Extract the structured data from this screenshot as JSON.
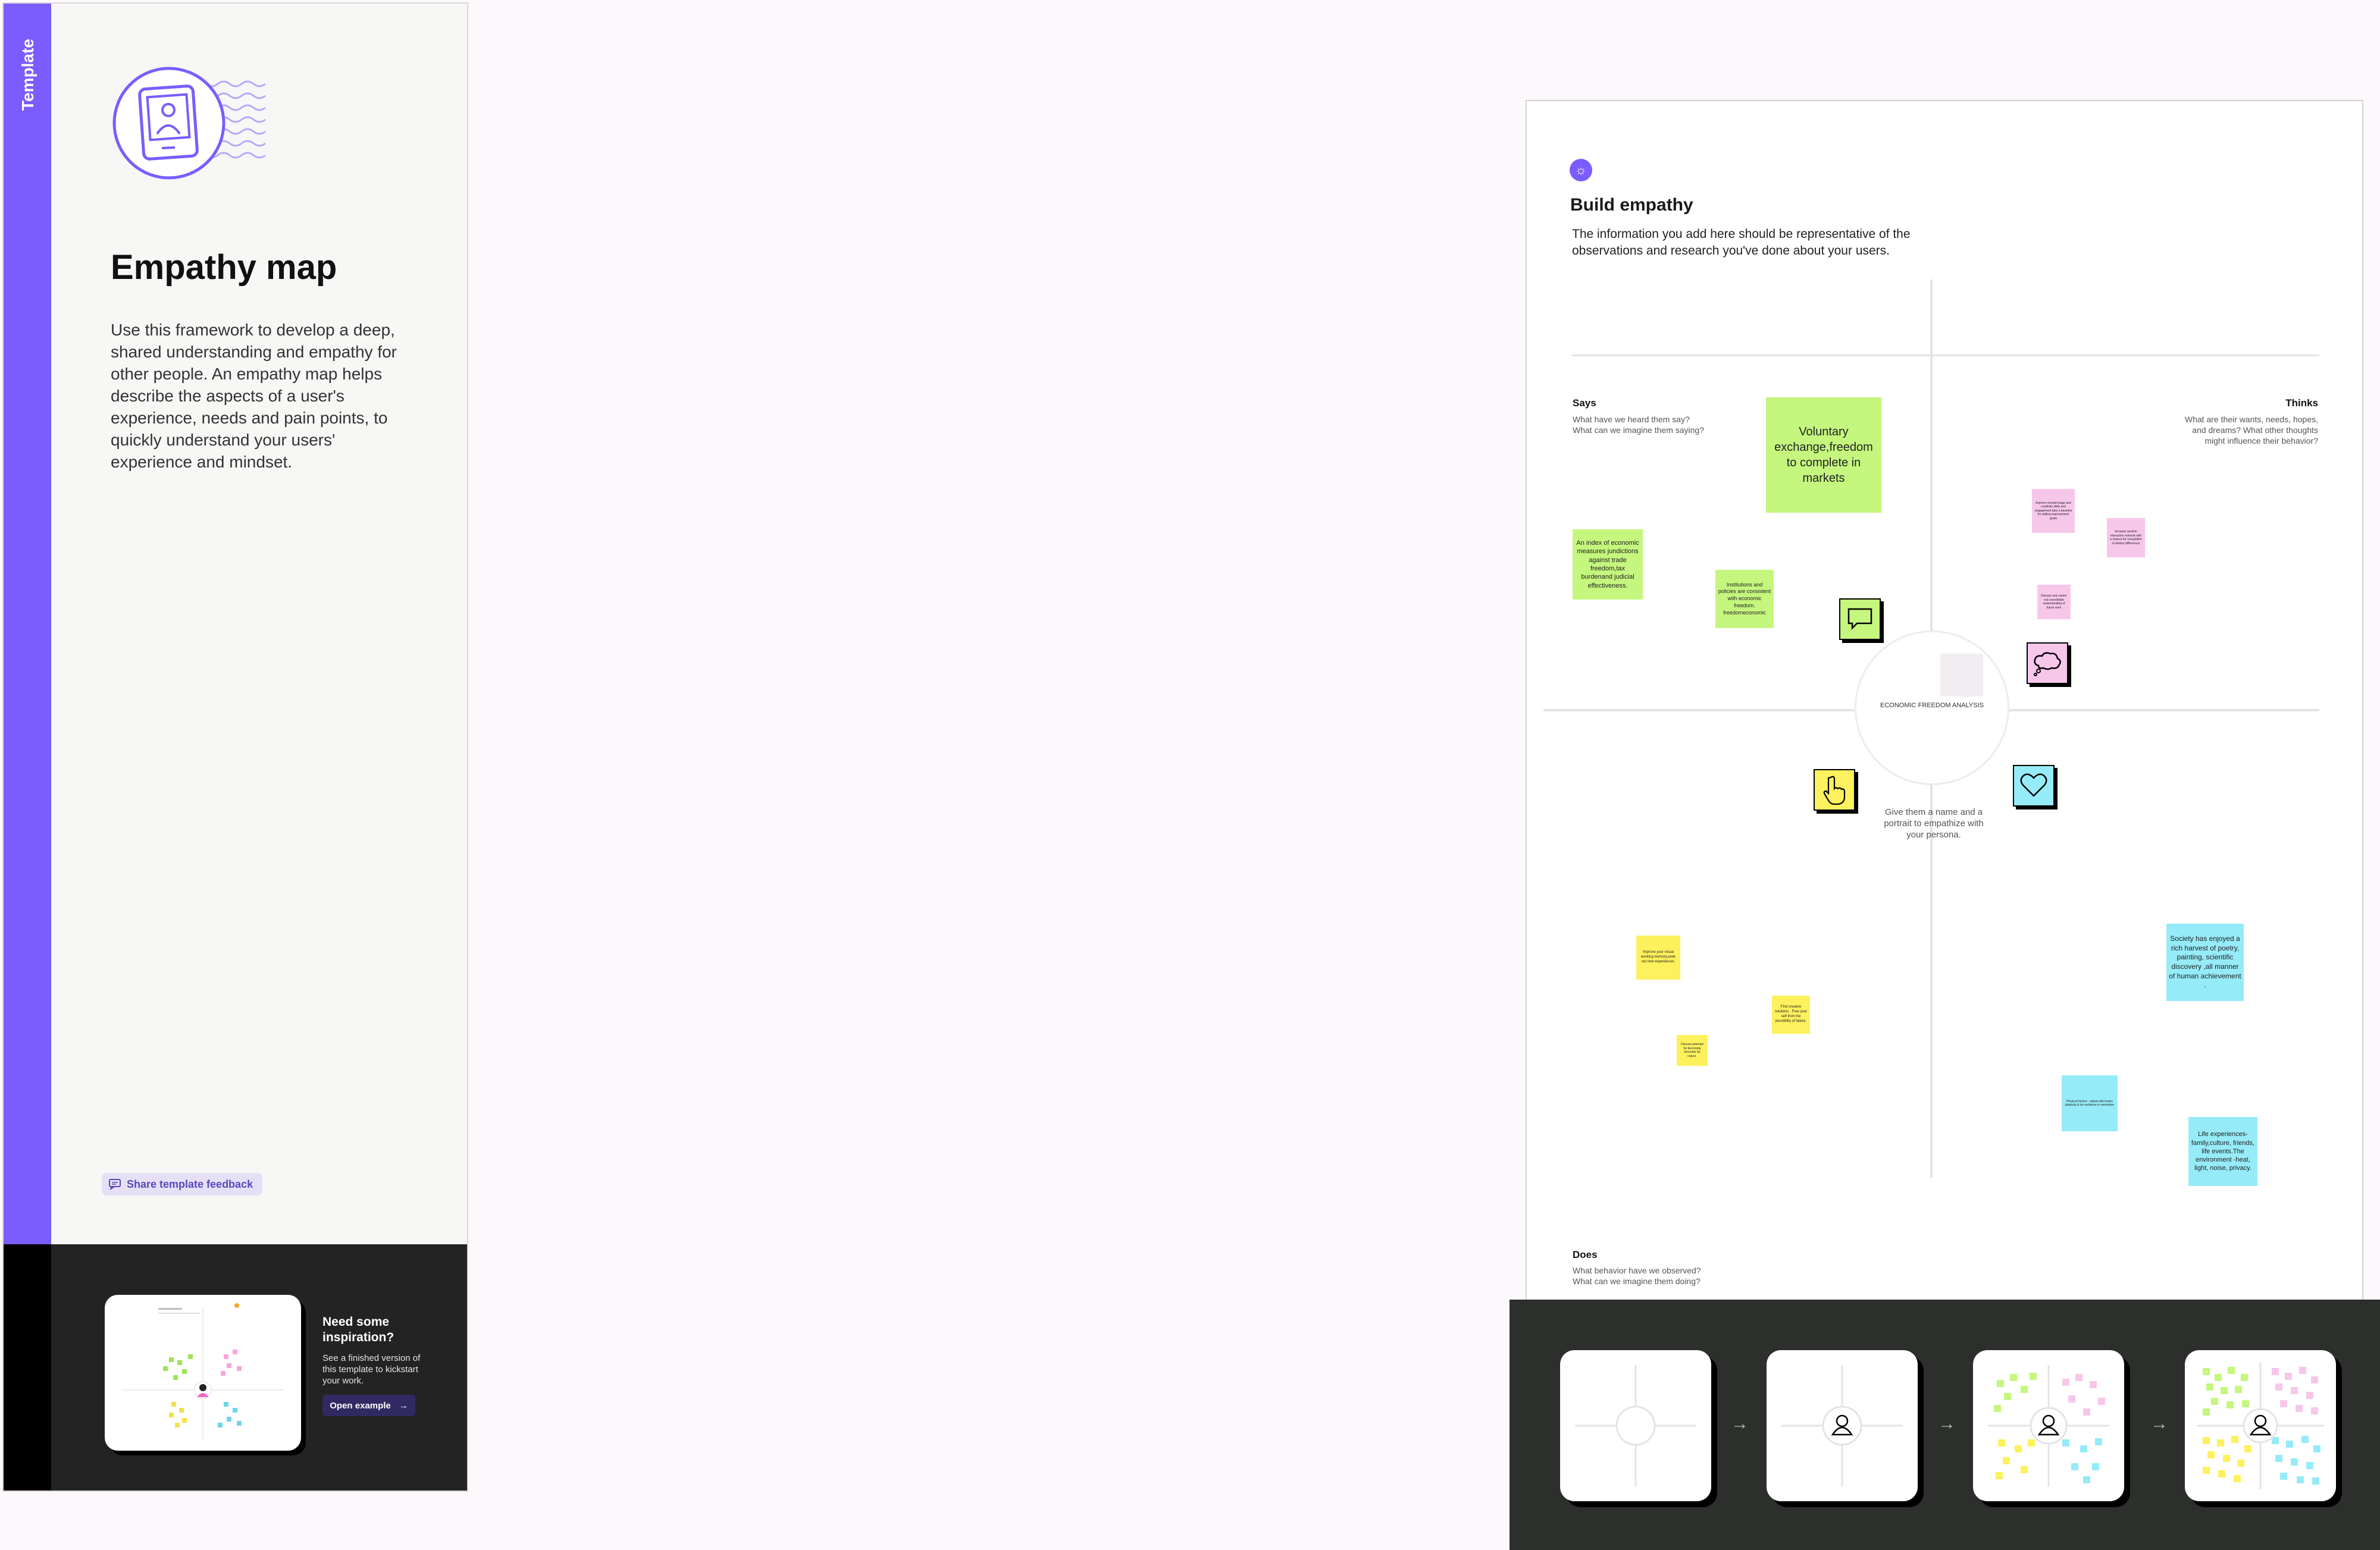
{
  "template_panel": {
    "tab_label": "Template",
    "title": "Empathy map",
    "description": "Use this framework to develop a deep, shared understanding and empathy for other people. An empathy map helps describe the aspects of a user's experience, needs and pain points, to quickly understand your users' experience and mindset.",
    "feedback_button": "Share template feedback",
    "inspiration": {
      "title": "Need some inspiration?",
      "description": "See a finished version of this template to kickstart your work.",
      "button": "Open example"
    }
  },
  "board": {
    "heading": "Build empathy",
    "description": "The information you add here should be representative of the observations and research you've done about your users.",
    "center_label": "ECONOMIC FREEDOM ANALYSIS",
    "persona_hint": "Give them a name and a portrait to empathize with your persona.",
    "quadrants": {
      "says": {
        "title": "Says",
        "desc1": "What have we heard them say?",
        "desc2": "What can we imagine them saying?"
      },
      "thinks": {
        "title": "Thinks",
        "desc1": "What are their wants, needs, hopes,",
        "desc2": "and dreams? What other thoughts",
        "desc3": "might influence their behavior?"
      },
      "does": {
        "title": "Does",
        "desc1": "What behavior have we observed?",
        "desc2": "What can we imagine them doing?"
      }
    },
    "stickies": {
      "voluntary": "Voluntary exchange,freedom to complete in markets",
      "index": "An index of economic measures jundictions against trade freedom,tax burdenand judicial effectiveness.",
      "institutions": "Institutions and policies are consistent with economic freedom. freedomeconomic",
      "pink1": "Improve mental image and creativity skills and engagement take a baseline for skilling improvement goals",
      "pink2": "Increase random interaction network with a chance for recognition of distinct differences",
      "pink3": "Discuss new career out consolidate understanding of future work",
      "yellow1": "Improve your visual working memory,seek out new experiences.",
      "yellow2": "Find creative solutions . Free your self from the possibility of failure.",
      "yellow3": "Discuss potential for becoming innovator by nature.",
      "society": "Society has enjoyed a rich harvest of poetry, painting, scientific discovery ,all manner of human achievement .",
      "physical": "Physical factors : adjust with brains plasticity & its resilience in remember",
      "life": "Life experiences-family,culture, friends, life events.The environment -heat, light, noise, privacy."
    },
    "icons": {
      "says": "speech-bubble-icon",
      "thinks": "thought-bubble-icon",
      "does": "pointing-hand-icon",
      "feels": "heart-icon"
    }
  },
  "progression": {
    "steps": [
      "empty-map",
      "persona-added",
      "notes-added",
      "full-map"
    ]
  }
}
